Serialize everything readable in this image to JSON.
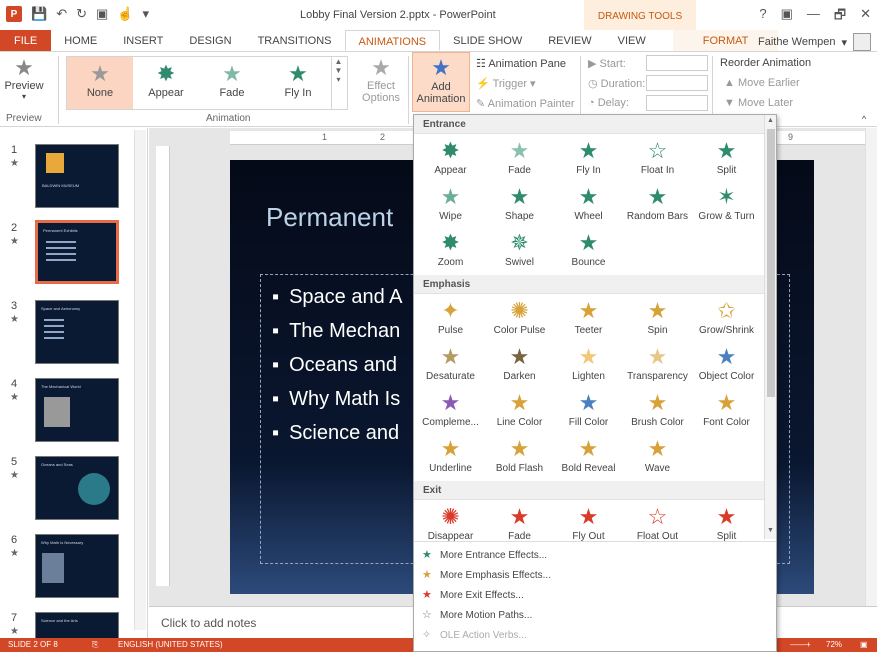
{
  "window": {
    "title": "Lobby Final Version 2.pptx - PowerPoint",
    "context_tab_group": "DRAWING TOOLS",
    "controls": [
      "?",
      "▣",
      "—",
      "🗗",
      "✕"
    ]
  },
  "tabs": [
    "FILE",
    "HOME",
    "INSERT",
    "DESIGN",
    "TRANSITIONS",
    "ANIMATIONS",
    "SLIDE SHOW",
    "REVIEW",
    "VIEW",
    "FORMAT"
  ],
  "user": {
    "name": "Faithe Wempen"
  },
  "ribbon": {
    "preview": {
      "label": "Preview",
      "group": "Preview"
    },
    "gallery": {
      "group": "Animation",
      "items": [
        {
          "label": "None"
        },
        {
          "label": "Appear"
        },
        {
          "label": "Fade"
        },
        {
          "label": "Fly In"
        }
      ]
    },
    "effect_options": {
      "line1": "Effect",
      "line2": "Options"
    },
    "add_animation": {
      "line1": "Add",
      "line2": "Animation"
    },
    "advanced": {
      "animation_pane": "Animation Pane",
      "trigger": "Trigger",
      "animation_painter": "Animation Painter"
    },
    "timing": {
      "start": "Start:",
      "duration": "Duration:",
      "delay": "Delay:"
    },
    "reorder": {
      "title": "Reorder Animation",
      "earlier": "Move Earlier",
      "later": "Move Later"
    }
  },
  "ruler": {
    "marks": [
      "1",
      "2",
      "9"
    ]
  },
  "slides": [
    {
      "num": "1"
    },
    {
      "num": "2"
    },
    {
      "num": "3"
    },
    {
      "num": "4"
    },
    {
      "num": "5"
    },
    {
      "num": "6"
    },
    {
      "num": "7"
    }
  ],
  "thumb_texts": {
    "slide1": "BALDWIN MUSEUM",
    "slide2": "Permanent Exhibits",
    "slide3": "Space and Astronomy",
    "slide4": "The Mechanical World",
    "slide5": "Oceans and Seas",
    "slide6": "Why Math Is Necessary",
    "slide7": "Science and the Arts"
  },
  "slide": {
    "title": "Permanent",
    "bullets": [
      "Space and A",
      "The Mechan",
      "Oceans and",
      "Why Math Is",
      "Science and"
    ]
  },
  "notes": {
    "placeholder": "Click to add notes"
  },
  "statusbar": {
    "slide": "SLIDE 2 OF 8",
    "language": "ENGLISH (UNITED STATES)",
    "zoom": "72%"
  },
  "dropdown": {
    "entrance": {
      "heading": "Entrance",
      "items": [
        "Appear",
        "Fade",
        "Fly In",
        "Float In",
        "Split",
        "Wipe",
        "Shape",
        "Wheel",
        "Random Bars",
        "Grow & Turn",
        "Zoom",
        "Swivel",
        "Bounce"
      ]
    },
    "emphasis": {
      "heading": "Emphasis",
      "items": [
        "Pulse",
        "Color Pulse",
        "Teeter",
        "Spin",
        "Grow/Shrink",
        "Desaturate",
        "Darken",
        "Lighten",
        "Transparency",
        "Object Color",
        "Compleme...",
        "Line Color",
        "Fill Color",
        "Brush Color",
        "Font Color",
        "Underline",
        "Bold Flash",
        "Bold Reveal",
        "Wave"
      ]
    },
    "exit": {
      "heading": "Exit",
      "items": [
        "Disappear",
        "Fade",
        "Fly Out",
        "Float Out",
        "Split"
      ]
    },
    "menu": [
      "More Entrance Effects...",
      "More Emphasis Effects...",
      "More Exit Effects...",
      "More Motion Paths...",
      "OLE Action Verbs..."
    ]
  }
}
